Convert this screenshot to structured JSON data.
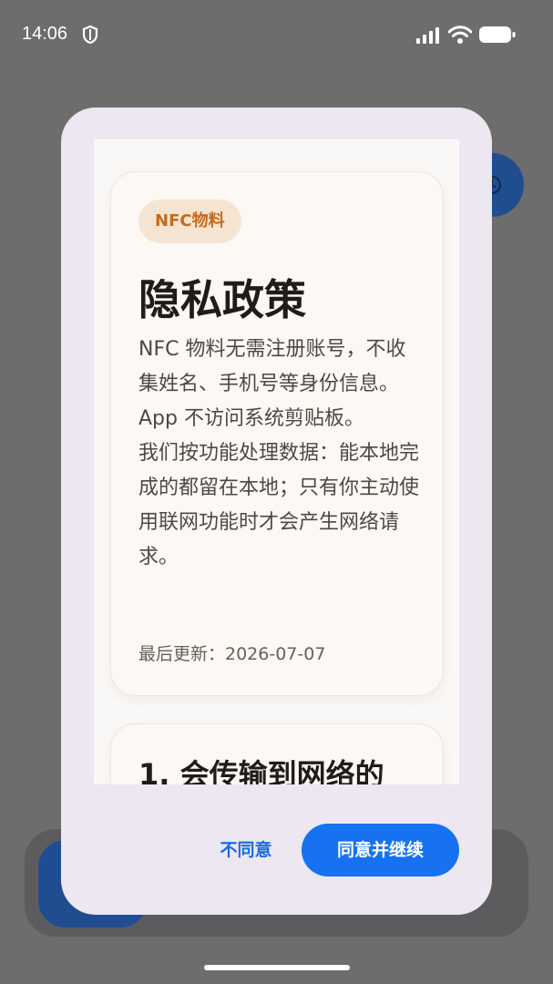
{
  "status_bar": {
    "time": "14:06"
  },
  "dialog": {
    "card": {
      "chip": "NFC物料",
      "title": "隐私政策",
      "paragraph1": "NFC 物料无需注册账号，不收集姓名、手机号等身份信息。App 不访问系统剪贴板。",
      "paragraph2": "我们按功能处理数据：能本地完成的都留在本地；只有你主动使用联网功能时才会产生网络请求。",
      "updated": "最后更新：2026-07-07"
    },
    "section": {
      "title": "1. 会传输到网络的"
    },
    "buttons": {
      "disagree": "不同意",
      "agree": "同意并继续"
    }
  },
  "colors": {
    "accent": "#1672f0",
    "chip_text": "#c66a1c",
    "chip_bg": "#f6e4d2"
  }
}
